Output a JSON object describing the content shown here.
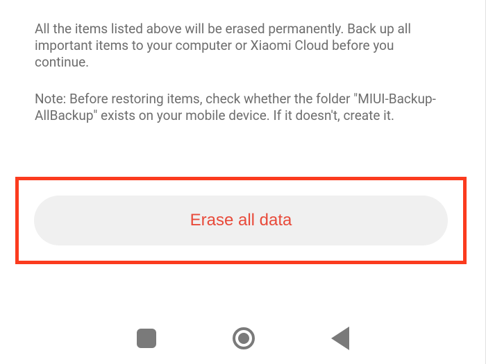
{
  "warning": "All the items listed above will be erased permanently. Back up all important items to your computer or Xiaomi Cloud before you continue.",
  "note": "Note: Before restoring items, check whether the folder \"MIUI-Backup-AllBackup\" exists on your mobile device. If it doesn't, create it.",
  "erase_button_label": "Erase all data"
}
